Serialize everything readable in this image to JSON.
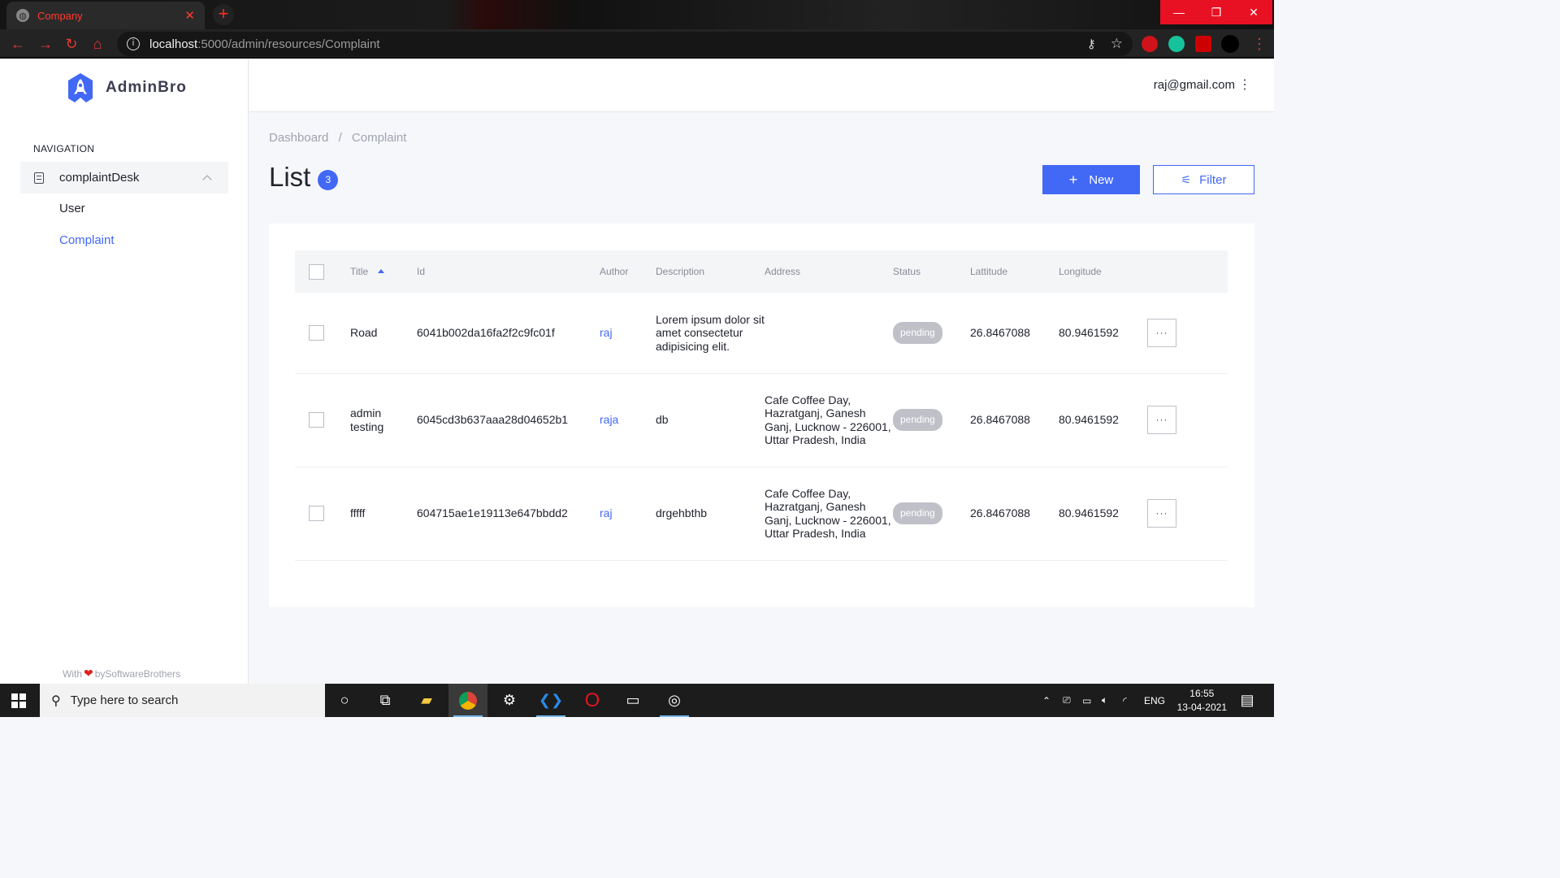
{
  "browser": {
    "tab_title": "Company",
    "url_host": "localhost",
    "url_path": ":5000/admin/resources/Complaint"
  },
  "sidebar": {
    "brand": "AdminBro",
    "nav_heading": "NAVIGATION",
    "group_label": "complaintDesk",
    "items": [
      {
        "label": "User",
        "active": false
      },
      {
        "label": "Complaint",
        "active": true
      }
    ],
    "footer_with": "With",
    "footer_by": "bySoftwareBrothers"
  },
  "topbar": {
    "user_email": "raj@gmail.com"
  },
  "breadcrumb": {
    "home": "Dashboard",
    "separator": "/",
    "current": "Complaint"
  },
  "page": {
    "title": "List",
    "count": "3",
    "new_label": "New",
    "filter_label": "Filter"
  },
  "table": {
    "headers": {
      "title": "Title",
      "id": "Id",
      "author": "Author",
      "description": "Description",
      "address": "Address",
      "status": "Status",
      "lattitude": "Lattitude",
      "longitude": "Longitude"
    },
    "rows": [
      {
        "title": "Road",
        "id": "6041b002da16fa2f2c9fc01f",
        "author": "raj",
        "description": "Lorem ipsum dolor sit amet consectetur adipisicing elit.",
        "address": "",
        "status": "pending",
        "lattitude": "26.8467088",
        "longitude": "80.9461592",
        "actions": "···"
      },
      {
        "title": "admin testing",
        "id": "6045cd3b637aaa28d04652b1",
        "author": "raja",
        "description": "db",
        "address": "Cafe Coffee Day, Hazratganj, Ganesh Ganj, Lucknow - 226001, Uttar Pradesh, India",
        "status": "pending",
        "lattitude": "26.8467088",
        "longitude": "80.9461592",
        "actions": "···"
      },
      {
        "title": "fffff",
        "id": "604715ae1e19113e647bbdd2",
        "author": "raj",
        "description": "drgehbthb",
        "address": "Cafe Coffee Day, Hazratganj, Ganesh Ganj, Lucknow - 226001, Uttar Pradesh, India",
        "status": "pending",
        "lattitude": "26.8467088",
        "longitude": "80.9461592",
        "actions": "···"
      }
    ]
  },
  "taskbar": {
    "search_placeholder": "Type here to search",
    "language": "ENG",
    "time": "16:55",
    "date": "13-04-2021"
  },
  "colors": {
    "accent": "#4268f6",
    "status_pending": "#c0c1c8",
    "browser_accent": "#ff3b30"
  }
}
